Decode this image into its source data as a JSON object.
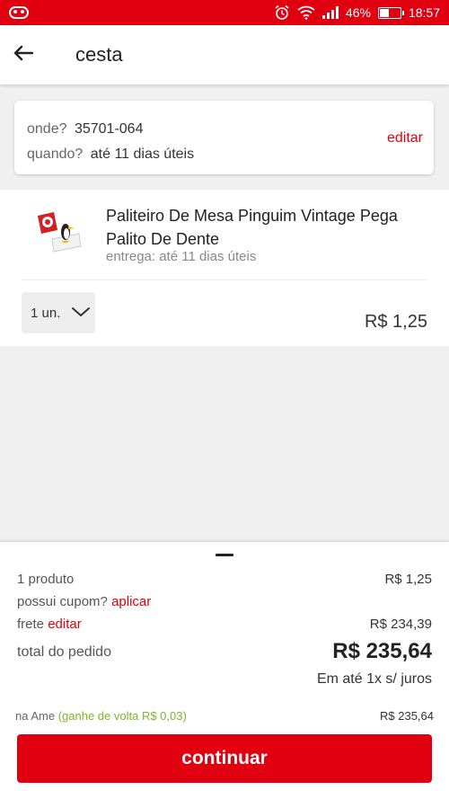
{
  "status_bar": {
    "battery": "46%",
    "time": "18:57",
    "battery_level": 0.46
  },
  "header": {
    "title": "cesta"
  },
  "delivery": {
    "where_label": "onde?",
    "where_value": "35701-064",
    "when_label": "quando?",
    "when_value": "até 11 dias úteis",
    "edit_label": "editar"
  },
  "item": {
    "name": "Paliteiro De Mesa Pinguim Vintage Pega Palito De Dente",
    "delivery": "entrega: até 11 dias úteis",
    "quantity": "1 un.",
    "price": "R$ 1,25"
  },
  "summary": {
    "products_label": "1 produto",
    "products_value": "R$ 1,25",
    "coupon_label": "possui cupom?",
    "coupon_link": "aplicar",
    "shipping_label": "frete",
    "shipping_link": "editar",
    "shipping_value": "R$ 234,39",
    "total_label": "total do pedido",
    "total_value": "R$ 235,64",
    "installments": "Em até 1x s/ juros",
    "ame_label": "na Ame",
    "ame_cashback": "(ganhe de volta R$ 0,03)",
    "ame_value": "R$ 235,64",
    "continue_label": "continuar"
  },
  "colors": {
    "brand": "#e0000f",
    "cashback": "#7fb32b"
  }
}
